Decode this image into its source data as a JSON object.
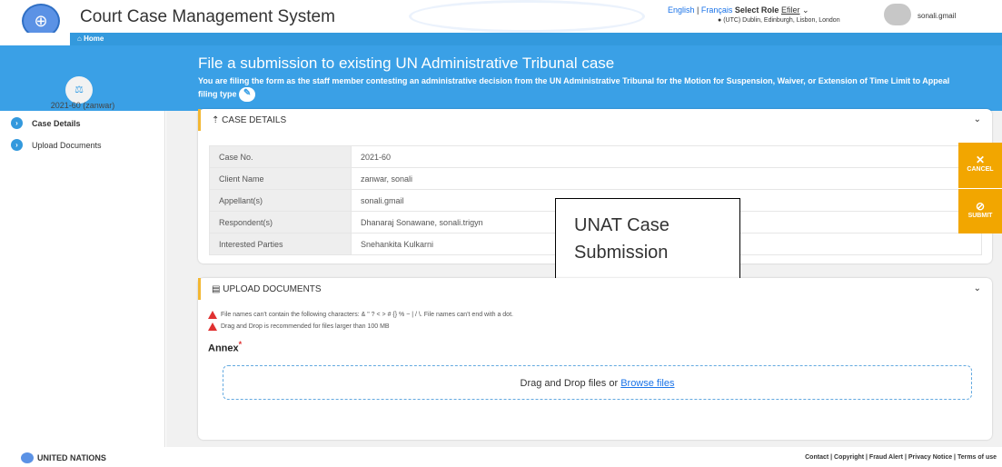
{
  "app": {
    "title": "Court Case Management System",
    "username": "sonali.gmail"
  },
  "lang": {
    "english": "English",
    "sep": " | ",
    "french": "Français",
    "select_role": "Select Role",
    "role": "Efiler",
    "timezone": "(UTC) Dublin, Edinburgh, Lisbon, London"
  },
  "nav": {
    "home": "Home"
  },
  "banner": {
    "title": "File a submission to existing UN Administrative Tribunal case",
    "desc": "You are filing the form as the staff member contesting an administrative decision from the UN Administrative Tribunal for the Motion for Suspension, Waiver, or Extension of Time Limit to Appeal",
    "filing_type": "filing type"
  },
  "sidebar": {
    "case_id": "2021-60 (zanwar)",
    "items": [
      {
        "label": "Case Details"
      },
      {
        "label": "Upload Documents"
      }
    ]
  },
  "case_details": {
    "heading": "CASE DETAILS",
    "rows": [
      {
        "label": "Case No.",
        "value": "2021-60"
      },
      {
        "label": "Client Name",
        "value": "zanwar, sonali"
      },
      {
        "label": "Appellant(s)",
        "value": "sonali.gmail"
      },
      {
        "label": "Respondent(s)",
        "value": "Dhanaraj Sonawane, sonali.trigyn"
      },
      {
        "label": "Interested Parties",
        "value": "Snehankita Kulkarni"
      }
    ]
  },
  "overlay": {
    "line1": "UNAT Case",
    "line2": "Submission"
  },
  "upload": {
    "heading": "UPLOAD DOCUMENTS",
    "warn1": "File names can't contain the following characters: & \" ? < > # {} % ~ | / \\. File names can't end with a dot.",
    "warn2": "Drag and Drop is recommended for files larger than 100 MB",
    "annex_label": "Annex",
    "drop_text": "Drag and Drop files or ",
    "browse": "Browse files"
  },
  "actions": {
    "cancel": "CANCEL",
    "submit": "SUBMIT"
  },
  "footer": {
    "org": "UNITED NATIONS",
    "links": "Contact | Copyright | Fraud Alert | Privacy Notice | Terms of use"
  },
  "colors": {
    "accent": "#3aa0e6",
    "action": "#f2a600",
    "section_border": "#f3b732"
  }
}
